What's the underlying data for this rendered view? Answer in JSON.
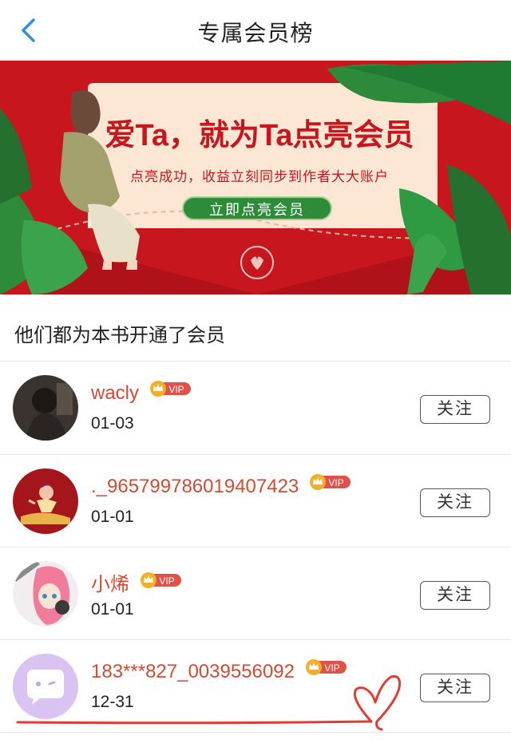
{
  "header": {
    "title": "专属会员榜",
    "back_icon": "chevron-left-icon"
  },
  "banner": {
    "headline": "爱Ta，就为Ta点亮会员",
    "subline": "点亮成功，收益立刻同步到作者大大账户",
    "cta": "立即点亮会员",
    "brand_color": "#c8161e",
    "cta_color": "#2e8b3a"
  },
  "section": {
    "title": "他们都为本书开通了会员"
  },
  "members": [
    {
      "name": "wacly",
      "badge": "VIP",
      "date": "01-03",
      "follow": "关注"
    },
    {
      "name": "._965799786019407423",
      "badge": "VIP",
      "date": "01-01",
      "follow": "关注"
    },
    {
      "name": "小烯",
      "badge": "VIP",
      "date": "01-01",
      "follow": "关注"
    },
    {
      "name": "183***827_0039556092",
      "badge": "VIP",
      "date": "12-31",
      "follow": "关注"
    }
  ],
  "colors": {
    "name": "#d44a31",
    "vip": "#e0514a",
    "crown": "#f2b02a",
    "back": "#2f8fe0"
  }
}
